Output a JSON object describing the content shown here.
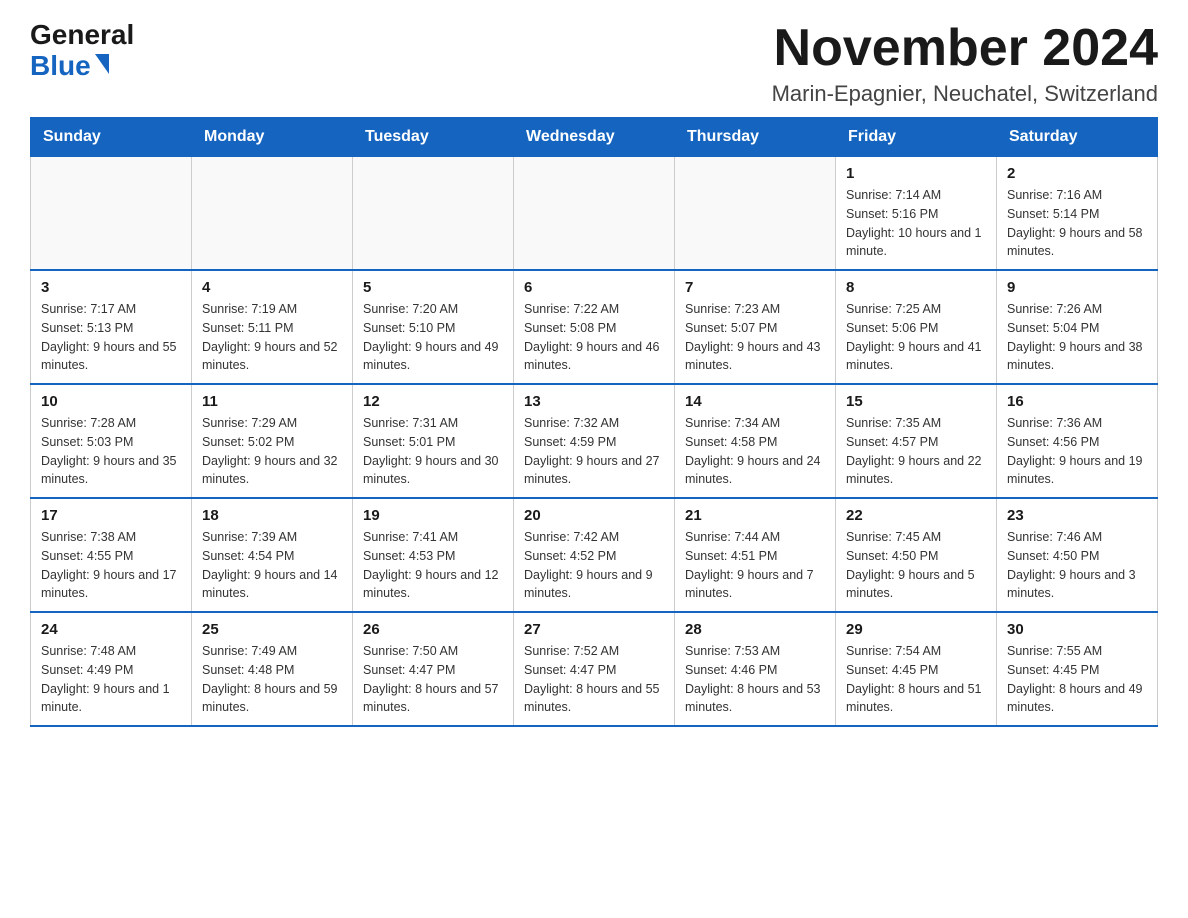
{
  "logo": {
    "general": "General",
    "blue": "Blue"
  },
  "title": "November 2024",
  "location": "Marin-Epagnier, Neuchatel, Switzerland",
  "days_of_week": [
    "Sunday",
    "Monday",
    "Tuesday",
    "Wednesday",
    "Thursday",
    "Friday",
    "Saturday"
  ],
  "weeks": [
    [
      {
        "day": "",
        "info": ""
      },
      {
        "day": "",
        "info": ""
      },
      {
        "day": "",
        "info": ""
      },
      {
        "day": "",
        "info": ""
      },
      {
        "day": "",
        "info": ""
      },
      {
        "day": "1",
        "info": "Sunrise: 7:14 AM\nSunset: 5:16 PM\nDaylight: 10 hours and 1 minute."
      },
      {
        "day": "2",
        "info": "Sunrise: 7:16 AM\nSunset: 5:14 PM\nDaylight: 9 hours and 58 minutes."
      }
    ],
    [
      {
        "day": "3",
        "info": "Sunrise: 7:17 AM\nSunset: 5:13 PM\nDaylight: 9 hours and 55 minutes."
      },
      {
        "day": "4",
        "info": "Sunrise: 7:19 AM\nSunset: 5:11 PM\nDaylight: 9 hours and 52 minutes."
      },
      {
        "day": "5",
        "info": "Sunrise: 7:20 AM\nSunset: 5:10 PM\nDaylight: 9 hours and 49 minutes."
      },
      {
        "day": "6",
        "info": "Sunrise: 7:22 AM\nSunset: 5:08 PM\nDaylight: 9 hours and 46 minutes."
      },
      {
        "day": "7",
        "info": "Sunrise: 7:23 AM\nSunset: 5:07 PM\nDaylight: 9 hours and 43 minutes."
      },
      {
        "day": "8",
        "info": "Sunrise: 7:25 AM\nSunset: 5:06 PM\nDaylight: 9 hours and 41 minutes."
      },
      {
        "day": "9",
        "info": "Sunrise: 7:26 AM\nSunset: 5:04 PM\nDaylight: 9 hours and 38 minutes."
      }
    ],
    [
      {
        "day": "10",
        "info": "Sunrise: 7:28 AM\nSunset: 5:03 PM\nDaylight: 9 hours and 35 minutes."
      },
      {
        "day": "11",
        "info": "Sunrise: 7:29 AM\nSunset: 5:02 PM\nDaylight: 9 hours and 32 minutes."
      },
      {
        "day": "12",
        "info": "Sunrise: 7:31 AM\nSunset: 5:01 PM\nDaylight: 9 hours and 30 minutes."
      },
      {
        "day": "13",
        "info": "Sunrise: 7:32 AM\nSunset: 4:59 PM\nDaylight: 9 hours and 27 minutes."
      },
      {
        "day": "14",
        "info": "Sunrise: 7:34 AM\nSunset: 4:58 PM\nDaylight: 9 hours and 24 minutes."
      },
      {
        "day": "15",
        "info": "Sunrise: 7:35 AM\nSunset: 4:57 PM\nDaylight: 9 hours and 22 minutes."
      },
      {
        "day": "16",
        "info": "Sunrise: 7:36 AM\nSunset: 4:56 PM\nDaylight: 9 hours and 19 minutes."
      }
    ],
    [
      {
        "day": "17",
        "info": "Sunrise: 7:38 AM\nSunset: 4:55 PM\nDaylight: 9 hours and 17 minutes."
      },
      {
        "day": "18",
        "info": "Sunrise: 7:39 AM\nSunset: 4:54 PM\nDaylight: 9 hours and 14 minutes."
      },
      {
        "day": "19",
        "info": "Sunrise: 7:41 AM\nSunset: 4:53 PM\nDaylight: 9 hours and 12 minutes."
      },
      {
        "day": "20",
        "info": "Sunrise: 7:42 AM\nSunset: 4:52 PM\nDaylight: 9 hours and 9 minutes."
      },
      {
        "day": "21",
        "info": "Sunrise: 7:44 AM\nSunset: 4:51 PM\nDaylight: 9 hours and 7 minutes."
      },
      {
        "day": "22",
        "info": "Sunrise: 7:45 AM\nSunset: 4:50 PM\nDaylight: 9 hours and 5 minutes."
      },
      {
        "day": "23",
        "info": "Sunrise: 7:46 AM\nSunset: 4:50 PM\nDaylight: 9 hours and 3 minutes."
      }
    ],
    [
      {
        "day": "24",
        "info": "Sunrise: 7:48 AM\nSunset: 4:49 PM\nDaylight: 9 hours and 1 minute."
      },
      {
        "day": "25",
        "info": "Sunrise: 7:49 AM\nSunset: 4:48 PM\nDaylight: 8 hours and 59 minutes."
      },
      {
        "day": "26",
        "info": "Sunrise: 7:50 AM\nSunset: 4:47 PM\nDaylight: 8 hours and 57 minutes."
      },
      {
        "day": "27",
        "info": "Sunrise: 7:52 AM\nSunset: 4:47 PM\nDaylight: 8 hours and 55 minutes."
      },
      {
        "day": "28",
        "info": "Sunrise: 7:53 AM\nSunset: 4:46 PM\nDaylight: 8 hours and 53 minutes."
      },
      {
        "day": "29",
        "info": "Sunrise: 7:54 AM\nSunset: 4:45 PM\nDaylight: 8 hours and 51 minutes."
      },
      {
        "day": "30",
        "info": "Sunrise: 7:55 AM\nSunset: 4:45 PM\nDaylight: 8 hours and 49 minutes."
      }
    ]
  ]
}
